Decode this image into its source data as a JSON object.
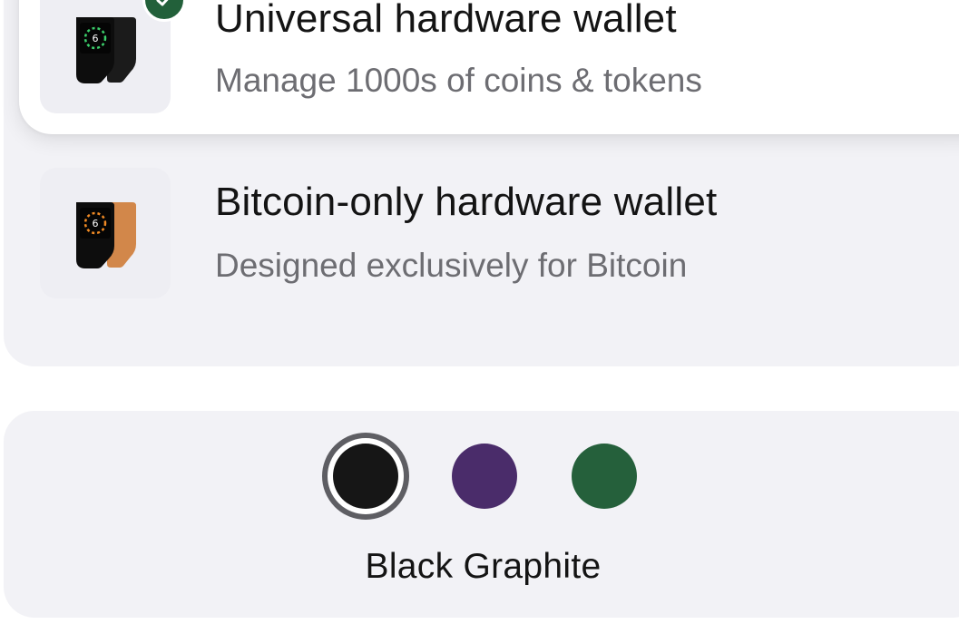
{
  "wallet_types": [
    {
      "title": "Universal hardware wallet",
      "description": "Manage 1000s of coins & tokens",
      "selected": true,
      "image": "black-device-pair-icon"
    },
    {
      "title": "Bitcoin-only hardware wallet",
      "description": "Designed exclusively for Bitcoin",
      "selected": false,
      "image": "black-orange-device-pair-icon"
    }
  ],
  "selected_badge_icon": "check-icon",
  "color_picker": {
    "selected_label": "Black Graphite",
    "swatches": [
      {
        "color": "#161616",
        "selected": true
      },
      {
        "color": "#4a2c6a",
        "selected": false
      },
      {
        "color": "#25603b",
        "selected": false
      }
    ]
  },
  "colors": {
    "accent": "#25603b",
    "panel_bg": "#f2f2f6",
    "title_text": "#141414",
    "secondary_text": "#6d6d72"
  }
}
